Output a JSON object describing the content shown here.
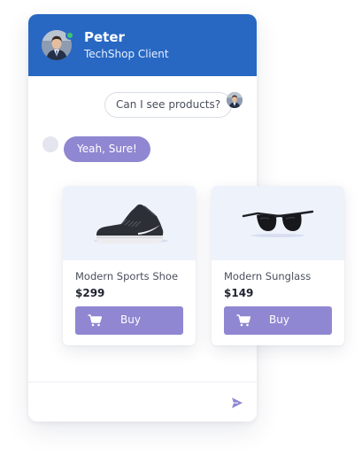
{
  "contact": {
    "name": "Peter",
    "subtitle": "TechShop Client",
    "status": "online",
    "status_color": "#3ec46d"
  },
  "messages": [
    {
      "from": "user",
      "text": "Can I see products?"
    },
    {
      "from": "bot",
      "text": "Yeah, Sure!"
    }
  ],
  "products": [
    {
      "name": "Modern Sports Shoe",
      "price": "$299",
      "image_icon": "sneaker-icon",
      "buy_label": "Buy"
    },
    {
      "name": "Modern Sunglass",
      "price": "$149",
      "image_icon": "sunglasses-icon",
      "buy_label": "Buy"
    }
  ],
  "composer": {
    "send_icon": "send-icon"
  },
  "colors": {
    "header": "#2868c3",
    "accent": "#8f87d1",
    "product_image_bg": "#eef2fb"
  }
}
